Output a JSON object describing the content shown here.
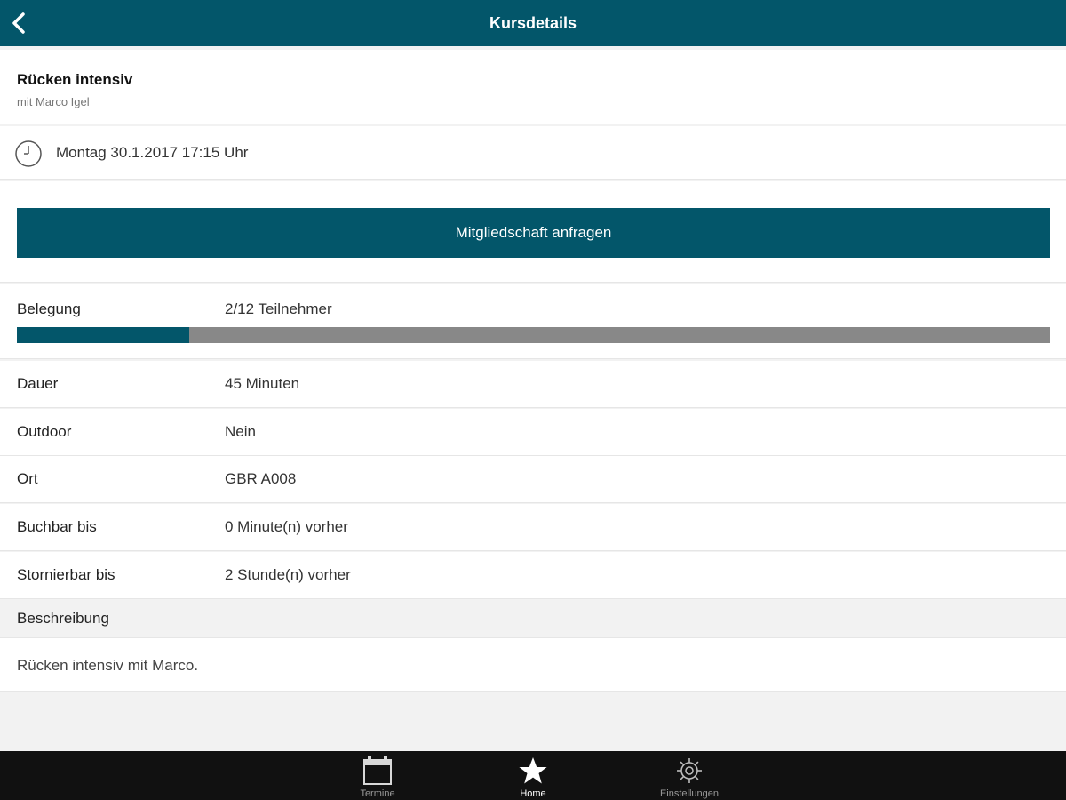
{
  "navbar": {
    "title": "Kursdetails",
    "back_icon": "chevron-left-icon"
  },
  "course": {
    "title": "Rücken intensiv",
    "trainer": "mit Marco Igel"
  },
  "schedule": {
    "icon": "clock-icon",
    "datetime": "Montag 30.1.2017 17:15 Uhr"
  },
  "actions": {
    "request_membership": "Mitgliedschaft anfragen"
  },
  "occupancy": {
    "label": "Belegung",
    "value": "2/12 Teilnehmer",
    "booked": 2,
    "capacity": 12
  },
  "details": [
    {
      "label": "Dauer",
      "value": "45 Minuten"
    },
    {
      "label": "Outdoor",
      "value": "Nein"
    },
    {
      "label": "Ort",
      "value": "GBR A008"
    },
    {
      "label": "Buchbar bis",
      "value": "0 Minute(n) vorher"
    },
    {
      "label": "Stornierbar bis",
      "value": "2 Stunde(n) vorher"
    }
  ],
  "description": {
    "header": "Beschreibung",
    "text": "Rücken intensiv mit Marco."
  },
  "tabbar": {
    "tabs": [
      {
        "label": "Termine",
        "icon": "calendar-icon",
        "active": false
      },
      {
        "label": "Home",
        "icon": "star-icon",
        "active": true
      },
      {
        "label": "Einstellungen",
        "icon": "gear-icon",
        "active": false
      }
    ]
  },
  "colors": {
    "primary": "#03566a",
    "progress_track": "#888888",
    "tabbar_bg": "#111111"
  }
}
